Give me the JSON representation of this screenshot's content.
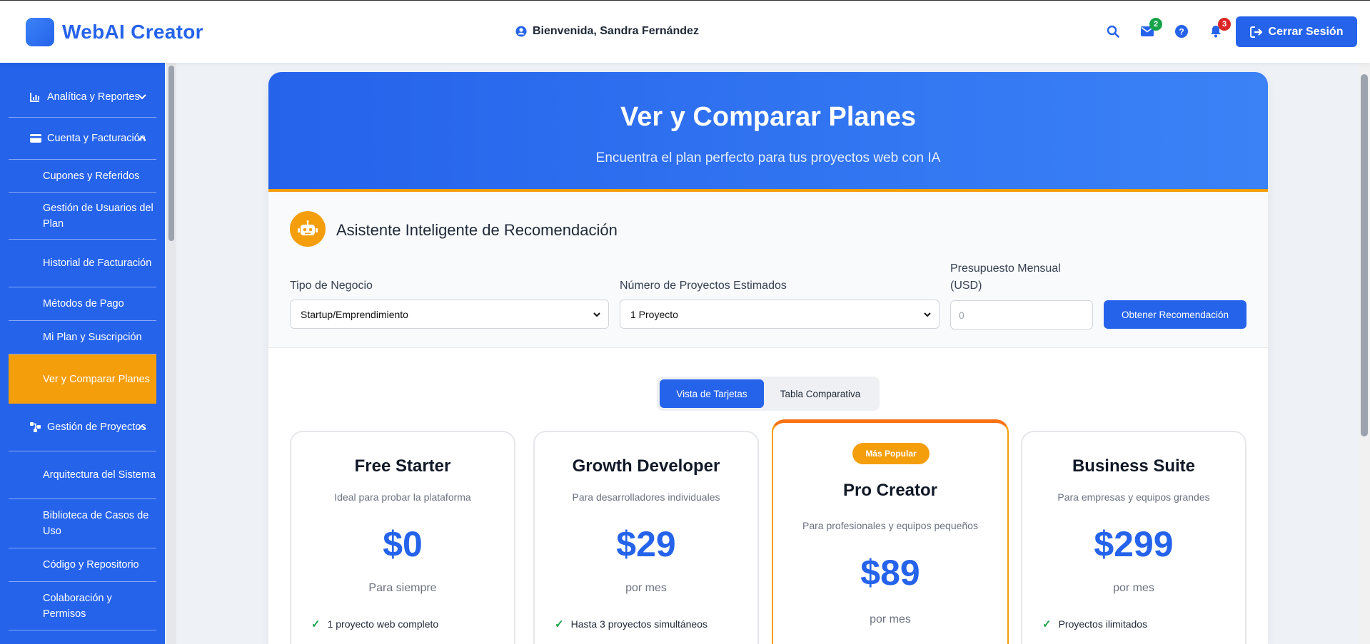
{
  "header": {
    "app_name": "WebAI Creator",
    "welcome": "Bienvenida, Sandra Fernández",
    "messages_count": "2",
    "notifications_count": "3",
    "logout_label": "Cerrar Sesión"
  },
  "sidebar": {
    "items": [
      {
        "label": "Analítica y Reportes",
        "icon": "chart-icon"
      },
      {
        "label": "Cuenta y Facturación",
        "icon": "credit-card-icon"
      },
      {
        "label": "Cupones y Referidos"
      },
      {
        "label": "Gestión de Usuarios del Plan"
      },
      {
        "label": "Historial de Facturación"
      },
      {
        "label": "Métodos de Pago"
      },
      {
        "label": "Mi Plan y Suscripción"
      },
      {
        "label": "Ver y Comparar Planes",
        "active": true
      },
      {
        "label": "Gestión de Proyectos",
        "icon": "project-tree-icon"
      },
      {
        "label": "Arquitectura del Sistema"
      },
      {
        "label": "Biblioteca de Casos de Uso"
      },
      {
        "label": "Código y Repositorio"
      },
      {
        "label": "Colaboración y Permisos"
      }
    ]
  },
  "hero": {
    "title": "Ver y Comparar Planes",
    "subtitle": "Encuentra el plan perfecto para tus proyectos web con IA"
  },
  "assistant": {
    "title": "Asistente Inteligente de Recomendación",
    "business_label": "Tipo de Negocio",
    "business_value": "Startup/Emprendimiento",
    "projects_label": "Número de Proyectos Estimados",
    "projects_value": "1 Proyecto",
    "budget_label_line1": "Presupuesto Mensual",
    "budget_label_line2": "(USD)",
    "budget_placeholder": "0",
    "recommend_button": "Obtener Recomendación"
  },
  "view_toggle": {
    "cards": "Vista de Tarjetas",
    "table": "Tabla Comparativa"
  },
  "plans": [
    {
      "name": "Free Starter",
      "desc": "Ideal para probar la plataforma",
      "price": "$0",
      "period": "Para siempre",
      "feature": "1 proyecto web completo"
    },
    {
      "name": "Growth Developer",
      "desc": "Para desarrolladores individuales",
      "price": "$29",
      "period": "por mes",
      "feature": "Hasta 3 proyectos simultáneos"
    },
    {
      "name": "Pro Creator",
      "desc": "Para profesionales y equipos pequeños",
      "price": "$89",
      "period": "por mes",
      "badge": "Más Popular"
    },
    {
      "name": "Business Suite",
      "desc": "Para empresas y equipos grandes",
      "price": "$299",
      "period": "por mes",
      "feature": "Proyectos ilimitados"
    }
  ],
  "colors": {
    "primary": "#2563eb",
    "accent": "#f59e0b",
    "success": "#16a34a",
    "danger": "#dc2626"
  }
}
